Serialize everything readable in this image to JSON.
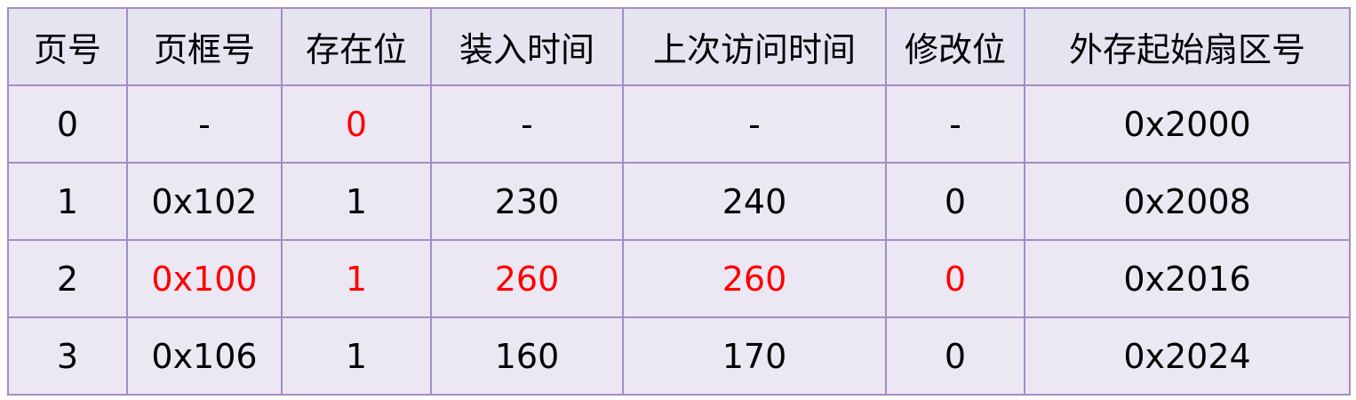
{
  "table": {
    "headers": [
      "页号",
      "页框号",
      "存在位",
      "装入时间",
      "上次访问时间",
      "修改位",
      "外存起始扇区号"
    ],
    "rows": [
      [
        "0",
        "-",
        "0",
        "-",
        "-",
        "-",
        "0x2000"
      ],
      [
        "1",
        "0x102",
        "1",
        "230",
        "240",
        "0",
        "0x2008"
      ],
      [
        "2",
        "0x100",
        "1",
        "260",
        "260",
        "0",
        "0x2016"
      ],
      [
        "3",
        "0x106",
        "1",
        "160",
        "170",
        "0",
        "0x2024"
      ]
    ]
  },
  "colors": {
    "highlight_text": "#ff0000",
    "border": "#a58cc6",
    "cell_background": "#ebe8f3"
  }
}
